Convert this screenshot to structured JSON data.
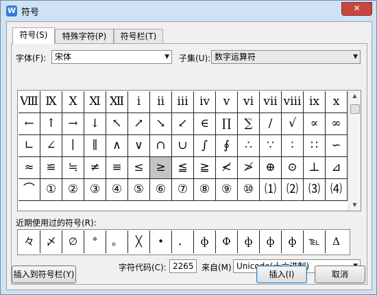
{
  "window": {
    "title": "符号",
    "icon_letter": "W",
    "close_label": "✕"
  },
  "tabs": [
    {
      "label": "符号(S)",
      "active": true
    },
    {
      "label": "特殊字符(P)",
      "active": false
    },
    {
      "label": "符号栏(T)",
      "active": false
    }
  ],
  "font": {
    "label": "字体(F):",
    "value": "宋体"
  },
  "subset": {
    "label": "子集(U):",
    "value": "数字运算符"
  },
  "symbol_grid": [
    [
      "Ⅷ",
      "Ⅸ",
      "Ⅹ",
      "Ⅺ",
      "Ⅻ",
      "ⅰ",
      "ⅱ",
      "ⅲ",
      "ⅳ",
      "ⅴ",
      "ⅵ",
      "ⅶ",
      "ⅷ",
      "ⅸ",
      "ⅹ"
    ],
    [
      "←",
      "↑",
      "→",
      "↓",
      "↖",
      "↗",
      "↘",
      "↙",
      "∈",
      "∏",
      "∑",
      "∕",
      "√",
      "∝",
      "∞"
    ],
    [
      "∟",
      "∠",
      "∣",
      "∥",
      "∧",
      "∨",
      "∩",
      "∪",
      "∫",
      "∮",
      "∴",
      "∵",
      "∶",
      "∷",
      "∽"
    ],
    [
      "≈",
      "≌",
      "≒",
      "≠",
      "≡",
      "≤",
      "≥",
      "≦",
      "≧",
      "≮",
      "≯",
      "⊕",
      "⊙",
      "⊥",
      "⊿"
    ],
    [
      "⌒",
      "①",
      "②",
      "③",
      "④",
      "⑤",
      "⑥",
      "⑦",
      "⑧",
      "⑨",
      "⑩",
      "⑴",
      "⑵",
      "⑶",
      "⑷"
    ]
  ],
  "selected_symbol": "≥",
  "recent": {
    "label": "近期使用过的符号(R):",
    "symbols": [
      "々",
      "〆",
      "∅",
      "°",
      "。",
      "╳",
      "•",
      "．",
      "ф",
      "Ф",
      "ф",
      "ф",
      "ф",
      "℡",
      "Δ"
    ]
  },
  "char_code": {
    "label": "字符代码(C):",
    "value": "2265"
  },
  "from": {
    "label": "来自(M)",
    "value": "Unicode(十六进制)"
  },
  "buttons": {
    "insert_to_bar": "插入到符号栏(Y)",
    "insert": "插入(I)",
    "cancel": "取消"
  }
}
